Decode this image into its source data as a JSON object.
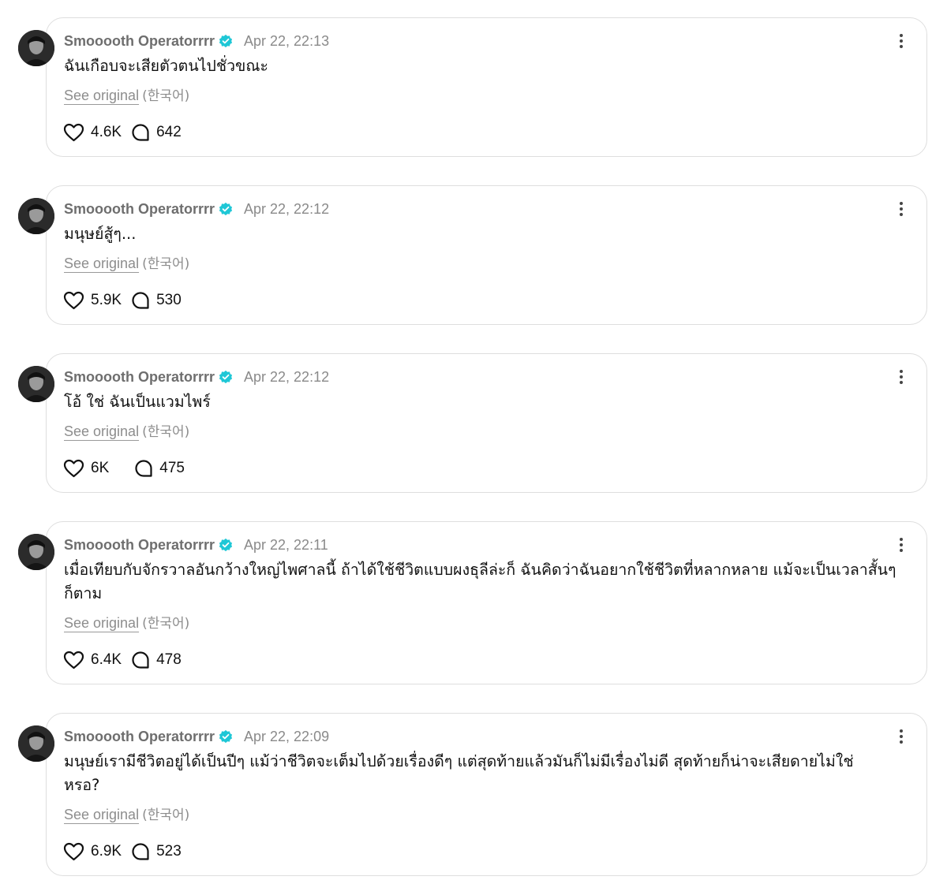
{
  "colors": {
    "verified": "#1ec7d6",
    "meta": "#8a8a8a",
    "border": "#dedede"
  },
  "icons": {
    "like": "heart-icon",
    "reply": "comment-bubble-icon",
    "verified": "verified-badge-icon",
    "more": "more-vertical-icon"
  },
  "posts": [
    {
      "author": "Smooooth Operatorrrr",
      "time": "Apr 22, 22:13",
      "text": "ฉันเกือบจะเสียตัวตนไปชั่วขณะ",
      "see_original": "See original",
      "original_lang": "(한국어)",
      "likes": "4.6K",
      "replies": "642"
    },
    {
      "author": "Smooooth Operatorrrr",
      "time": "Apr 22, 22:12",
      "text": "มนุษย์สู้ๆ...",
      "see_original": "See original",
      "original_lang": "(한국어)",
      "likes": "5.9K",
      "replies": "530"
    },
    {
      "author": "Smooooth Operatorrrr",
      "time": "Apr 22, 22:12",
      "text": "โอ้ ใช่ ฉันเป็นแวมไพร์",
      "see_original": "See original",
      "original_lang": "(한국어)",
      "likes": "6K",
      "replies": "475"
    },
    {
      "author": "Smooooth Operatorrrr",
      "time": "Apr 22, 22:11",
      "text": "เมื่อเทียบกับจักรวาลอันกว้างใหญ่ไพศาลนี้ ถ้าได้ใช้ชีวิตแบบผงธุลีล่ะก็ ฉันคิดว่าฉันอยากใช้ชีวิตที่หลากหลาย แม้จะเป็นเวลาสั้นๆก็ตาม",
      "see_original": "See original",
      "original_lang": "(한국어)",
      "likes": "6.4K",
      "replies": "478"
    },
    {
      "author": "Smooooth Operatorrrr",
      "time": "Apr 22, 22:09",
      "text": "มนุษย์เรามีชีวิตอยู่ได้เป็นปีๆ แม้ว่าชีวิตจะเต็มไปด้วยเรื่องดีๆ แต่สุดท้ายแล้วมันก็ไม่มีเรื่องไม่ดี สุดท้ายก็น่าจะเสียดายไม่ใช่หรอ?",
      "see_original": "See original",
      "original_lang": "(한국어)",
      "likes": "6.9K",
      "replies": "523"
    }
  ]
}
